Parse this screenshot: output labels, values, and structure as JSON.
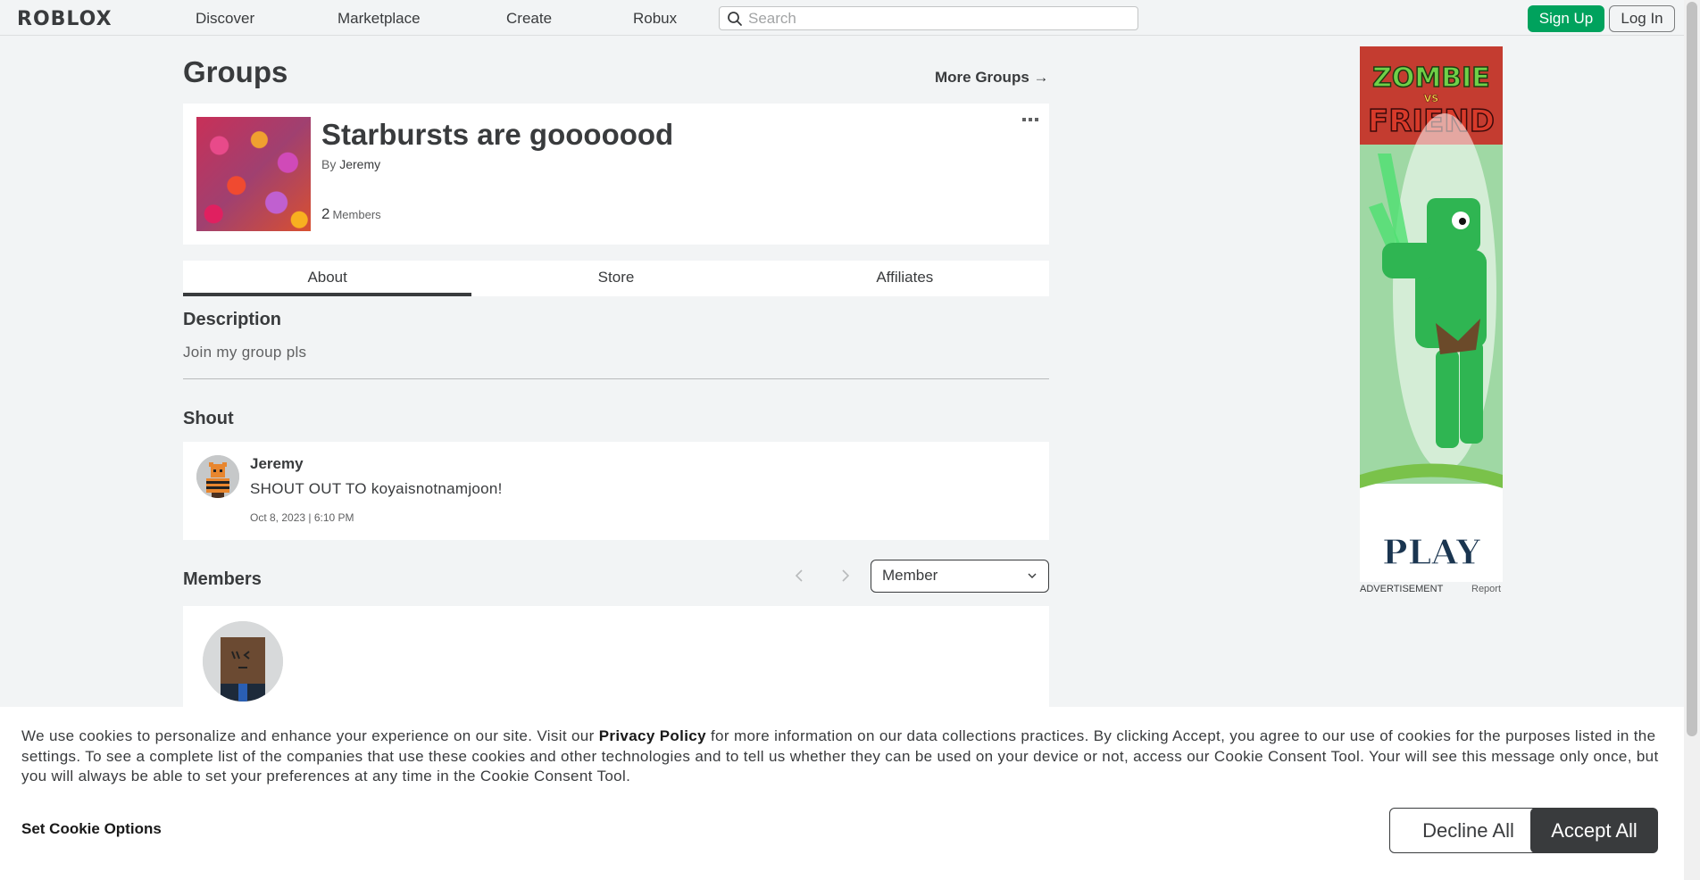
{
  "nav": {
    "logo": "ROBLOX",
    "links": [
      "Discover",
      "Marketplace",
      "Create",
      "Robux"
    ],
    "search_placeholder": "Search",
    "signup_label": "Sign Up",
    "login_label": "Log In"
  },
  "page": {
    "title": "Groups",
    "more_groups": "More Groups →"
  },
  "group": {
    "name": "Starbursts are gooooood",
    "by_prefix": "By",
    "owner": "Jeremy",
    "member_count": "2",
    "member_label": "Members"
  },
  "tabs": [
    {
      "label": "About",
      "active": true
    },
    {
      "label": "Store",
      "active": false
    },
    {
      "label": "Affiliates",
      "active": false
    }
  ],
  "description": {
    "heading": "Description",
    "text": "Join my group pls"
  },
  "shout": {
    "heading": "Shout",
    "author": "Jeremy",
    "body": "SHOUT OUT TO koyaisnotnamjoon!",
    "date": "Oct 8, 2023 | 6:10 PM"
  },
  "members": {
    "heading": "Members",
    "role_selected": "Member"
  },
  "ad": {
    "title_line1": "ZOMBIE",
    "title_vs": "VS",
    "title_line2": "FRIEND",
    "cta": "PLAY",
    "label": "ADVERTISEMENT",
    "report": "Report"
  },
  "cookie": {
    "text_before": "We use cookies to personalize and enhance your experience on our site. Visit our ",
    "privacy_link": "Privacy Policy",
    "text_after": " for more information on our data collections practices. By clicking Accept, you agree to our use of cookies for the purposes listed in the settings. To see a complete list of the companies that use these cookies and other technologies and to tell us whether they can be used on your device or not, access our Cookie Consent Tool. Your will see this message only once, but you will always be able to set your preferences at any time in the Cookie Consent Tool.",
    "set_options": "Set Cookie Options",
    "decline": "Decline All",
    "accept": "Accept All"
  },
  "colors": {
    "signup_green": "#00a25d",
    "accept_dark": "#393b3d",
    "page_bg": "#f2f4f5"
  }
}
